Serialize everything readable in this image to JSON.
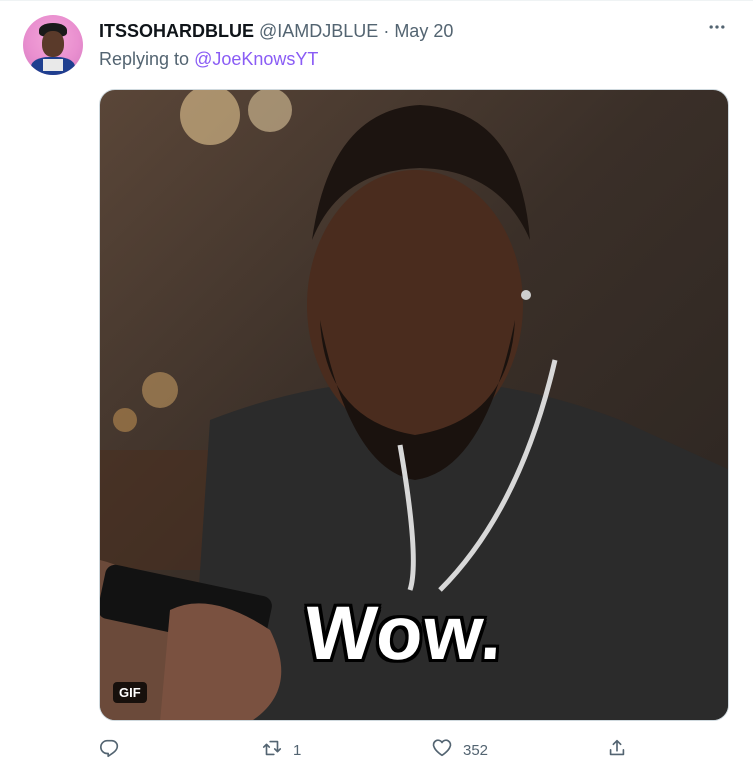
{
  "tweet": {
    "author_name": "ITSSOHARDBLUE",
    "author_handle": "@IAMDJBLUE",
    "separator": "·",
    "date": "May 20",
    "reply_prefix": "Replying to",
    "reply_to": "@JoeKnowsYT",
    "media": {
      "caption": "Wow.",
      "badge": "GIF"
    },
    "actions": {
      "reply_count": "",
      "retweet_count": "1",
      "like_count": "352"
    },
    "icons": {
      "more": "more-icon",
      "reply": "reply-icon",
      "retweet": "retweet-icon",
      "like": "heart-icon",
      "share": "share-icon"
    },
    "colors": {
      "secondary_text": "#536471",
      "link": "#8a5cf5",
      "primary_text": "#0f1419"
    }
  }
}
